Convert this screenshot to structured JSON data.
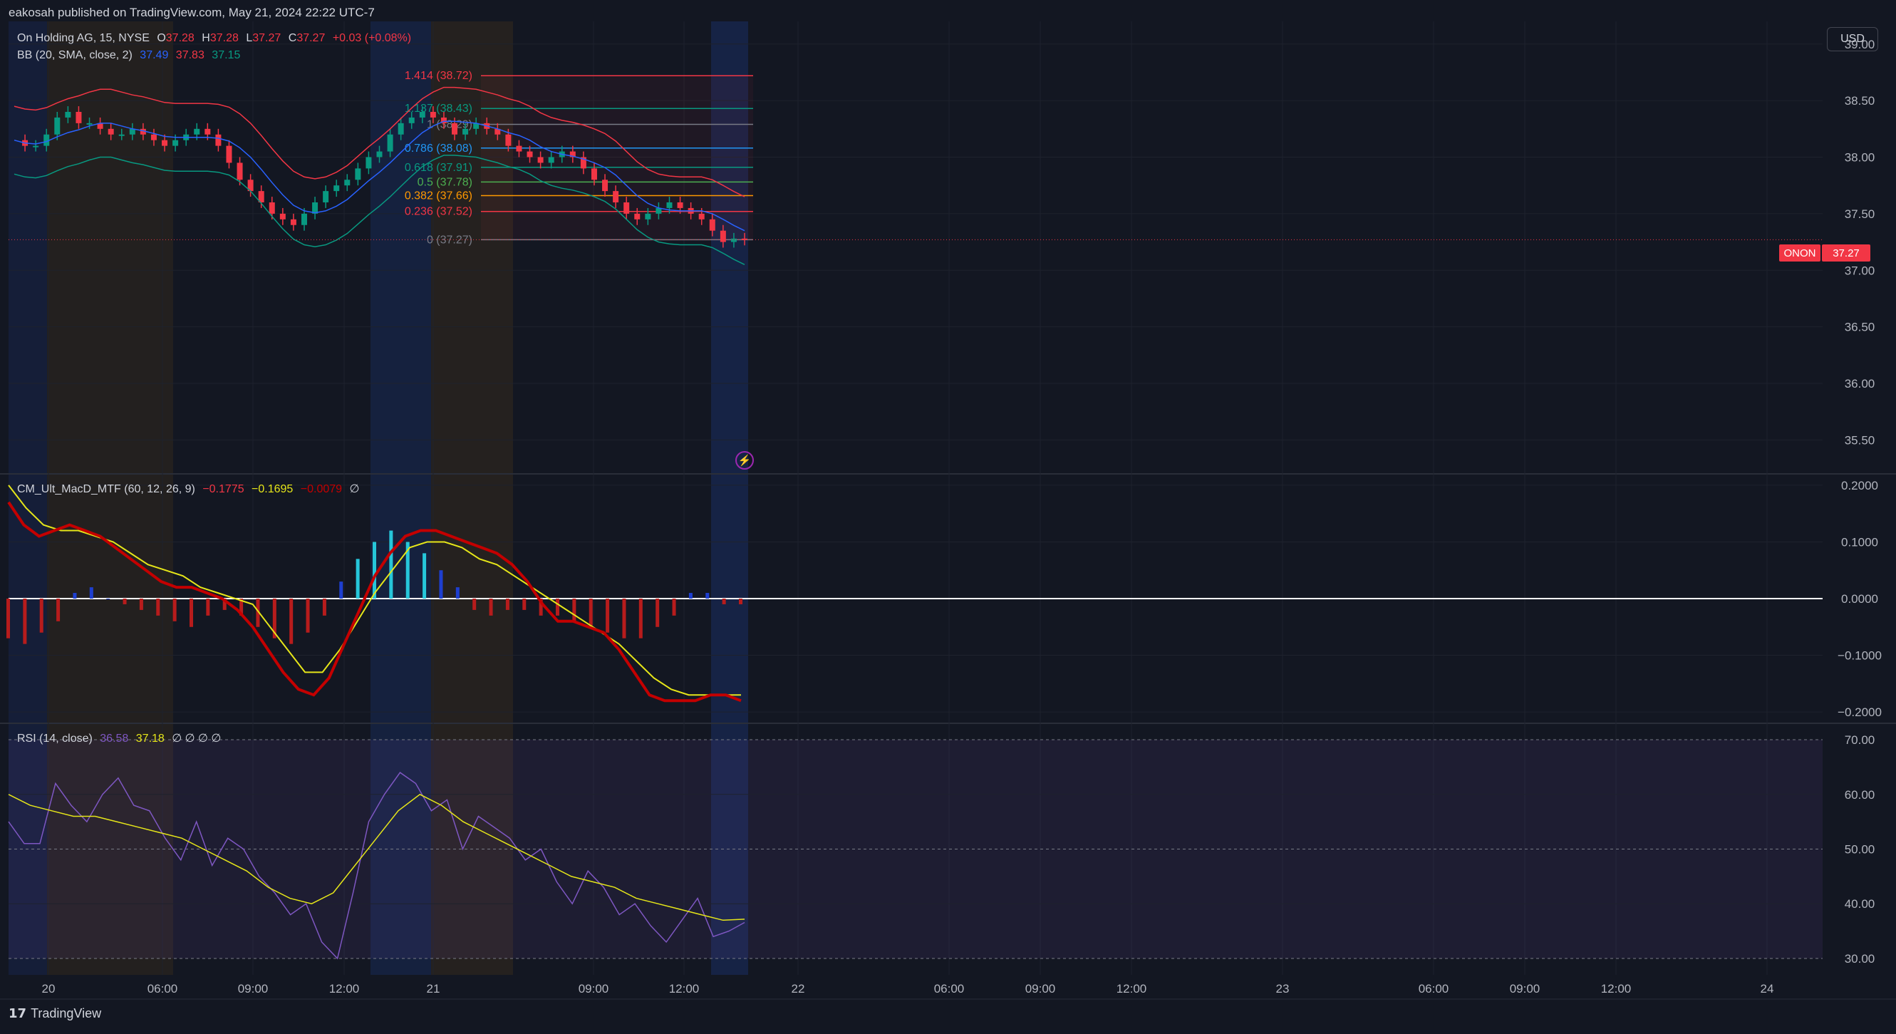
{
  "header": {
    "published": "eakosah published on TradingView.com, May 21, 2024 22:22 UTC-7"
  },
  "currency_button": "USD",
  "main_legend": {
    "symbol": "On Holding AG, 15, NYSE",
    "o_label": "O",
    "o_val": "37.28",
    "h_label": "H",
    "h_val": "37.28",
    "l_label": "L",
    "l_val": "37.27",
    "c_label": "C",
    "c_val": "37.27",
    "change": "+0.03 (+0.08%)"
  },
  "bb_legend": {
    "name": "BB (20, SMA, close, 2)",
    "basis": "37.49",
    "upper": "37.83",
    "lower": "37.15"
  },
  "macd_legend": {
    "name": "CM_Ult_MacD_MTF (60, 12, 26, 9)",
    "v1": "−0.1775",
    "v2": "−0.1695",
    "v3": "−0.0079",
    "v4": "∅"
  },
  "rsi_legend": {
    "name": "RSI (14, close)",
    "rsi": "36.58",
    "ma": "37.18",
    "na": "∅ ∅ ∅ ∅"
  },
  "price_tag": {
    "symbol": "ONON",
    "price": "37.27"
  },
  "footer": {
    "brand": "TradingView"
  },
  "colors": {
    "bg": "#131722",
    "up": "#089981",
    "down": "#f23645",
    "bb_basis": "#2962ff",
    "bb_upper": "#f23645",
    "bb_lower": "#089981",
    "macd": "#c40000",
    "signal": "#e6e619",
    "rsi": "#7e57c2"
  },
  "chart_data": [
    {
      "type": "candlestick",
      "title": "On Holding AG, 15, NYSE",
      "ylim": [
        35.2,
        39.2
      ],
      "y_ticks": [
        "39.00",
        "38.50",
        "38.00",
        "37.50",
        "37.00",
        "36.50",
        "36.00",
        "35.50"
      ],
      "x_ticks": [
        "20",
        "06:00",
        "09:00",
        "12:00",
        "21",
        "09:00",
        "12:00",
        "22",
        "06:00",
        "09:00",
        "12:00",
        "23",
        "06:00",
        "09:00",
        "12:00",
        "24"
      ],
      "close_path": [
        38.15,
        38.1,
        38.1,
        38.2,
        38.35,
        38.4,
        38.3,
        38.3,
        38.25,
        38.2,
        38.2,
        38.25,
        38.2,
        38.15,
        38.1,
        38.15,
        38.2,
        38.25,
        38.2,
        38.1,
        37.95,
        37.8,
        37.7,
        37.6,
        37.5,
        37.45,
        37.4,
        37.5,
        37.6,
        37.7,
        37.75,
        37.8,
        37.9,
        38.0,
        38.05,
        38.2,
        38.3,
        38.35,
        38.4,
        38.35,
        38.3,
        38.2,
        38.25,
        38.3,
        38.25,
        38.2,
        38.1,
        38.05,
        38.0,
        37.95,
        38.0,
        38.05,
        38.0,
        37.9,
        37.8,
        37.7,
        37.6,
        37.5,
        37.45,
        37.5,
        37.55,
        37.6,
        37.55,
        37.5,
        37.45,
        37.35,
        37.25,
        37.28,
        37.27
      ],
      "bollinger": {
        "basis": "37.49",
        "upper": "37.83",
        "lower": "37.15"
      },
      "fibonacci": [
        {
          "label": "1.414 (38.72)",
          "value": 38.72,
          "color": "#f23645"
        },
        {
          "label": "1.137 (38.43)",
          "value": 38.43,
          "color": "#089981"
        },
        {
          "label": "1 (38.29)",
          "value": 38.29,
          "color": "#787b86"
        },
        {
          "label": "0.786 (38.08)",
          "value": 38.08,
          "color": "#2196f3"
        },
        {
          "label": "0.618 (37.91)",
          "value": 37.91,
          "color": "#089981"
        },
        {
          "label": "0.5 (37.78)",
          "value": 37.78,
          "color": "#4caf50"
        },
        {
          "label": "0.382 (37.66)",
          "value": 37.66,
          "color": "#ff9800"
        },
        {
          "label": "0.236 (37.52)",
          "value": 37.52,
          "color": "#f23645"
        },
        {
          "label": "0 (37.27)",
          "value": 37.27,
          "color": "#787b86"
        }
      ]
    },
    {
      "type": "line",
      "title": "CM_Ult_MacD_MTF (60, 12, 26, 9)",
      "ylim": [
        -0.22,
        0.22
      ],
      "y_ticks": [
        "0.2000",
        "0.1000",
        "0.0000",
        "−0.1000",
        "−0.2000"
      ],
      "series": [
        {
          "name": "MACD",
          "values": [
            0.17,
            0.13,
            0.11,
            0.12,
            0.13,
            0.12,
            0.11,
            0.09,
            0.07,
            0.05,
            0.03,
            0.02,
            0.02,
            0.01,
            0.0,
            -0.02,
            -0.05,
            -0.09,
            -0.13,
            -0.16,
            -0.17,
            -0.14,
            -0.08,
            -0.02,
            0.04,
            0.08,
            0.11,
            0.12,
            0.12,
            0.11,
            0.1,
            0.09,
            0.08,
            0.06,
            0.03,
            -0.01,
            -0.04,
            -0.04,
            -0.05,
            -0.06,
            -0.09,
            -0.13,
            -0.17,
            -0.18,
            -0.18,
            -0.18,
            -0.17,
            -0.17,
            -0.18
          ]
        },
        {
          "name": "Signal",
          "values": [
            0.2,
            0.16,
            0.13,
            0.12,
            0.12,
            0.11,
            0.1,
            0.08,
            0.06,
            0.05,
            0.04,
            0.02,
            0.01,
            0.0,
            -0.01,
            -0.05,
            -0.09,
            -0.13,
            -0.13,
            -0.09,
            -0.04,
            0.01,
            0.05,
            0.09,
            0.1,
            0.1,
            0.09,
            0.07,
            0.06,
            0.04,
            0.02,
            0.0,
            -0.02,
            -0.04,
            -0.06,
            -0.08,
            -0.11,
            -0.14,
            -0.16,
            -0.17,
            -0.17,
            -0.17,
            -0.17
          ]
        },
        {
          "name": "Histogram",
          "values": [
            -0.07,
            -0.08,
            -0.06,
            -0.04,
            0.01,
            0.02,
            0.0,
            -0.01,
            -0.02,
            -0.03,
            -0.04,
            -0.05,
            -0.03,
            -0.02,
            -0.03,
            -0.05,
            -0.07,
            -0.08,
            -0.06,
            -0.03,
            0.03,
            0.07,
            0.1,
            0.12,
            0.1,
            0.08,
            0.05,
            0.02,
            -0.02,
            -0.03,
            -0.02,
            -0.02,
            -0.03,
            -0.03,
            -0.04,
            -0.05,
            -0.06,
            -0.07,
            -0.07,
            -0.05,
            -0.03,
            0.01,
            0.01,
            -0.01,
            -0.01
          ]
        }
      ]
    },
    {
      "type": "line",
      "title": "RSI (14, close)",
      "ylim": [
        27,
        73
      ],
      "y_ticks": [
        "70.00",
        "60.00",
        "50.00",
        "40.00",
        "30.00"
      ],
      "series": [
        {
          "name": "RSI",
          "values": [
            55,
            51,
            51,
            62,
            58,
            55,
            60,
            63,
            58,
            57,
            52,
            48,
            55,
            47,
            52,
            50,
            45,
            42,
            38,
            40,
            33,
            30,
            42,
            55,
            60,
            64,
            62,
            57,
            59,
            50,
            56,
            54,
            52,
            48,
            50,
            44,
            40,
            46,
            43,
            38,
            40,
            36,
            33,
            37,
            41,
            34,
            35,
            36.58
          ]
        },
        {
          "name": "RSI MA",
          "values": [
            60,
            58,
            57,
            56,
            56,
            55,
            54,
            53,
            52,
            50,
            48,
            46,
            43,
            41,
            40,
            42,
            47,
            52,
            57,
            60,
            58,
            55,
            53,
            51,
            49,
            47,
            45,
            44,
            43,
            41,
            40,
            39,
            38,
            37,
            37.18
          ]
        }
      ]
    }
  ]
}
